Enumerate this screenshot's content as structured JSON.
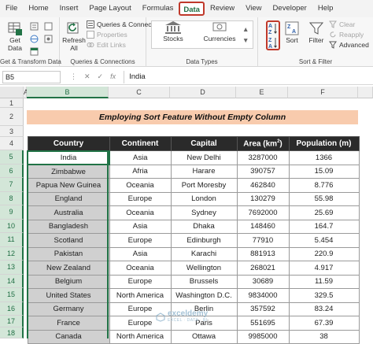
{
  "menu": [
    "File",
    "Home",
    "Insert",
    "Page Layout",
    "Formulas",
    "Data",
    "Review",
    "View",
    "Developer",
    "Help"
  ],
  "ribbon": {
    "get_data": "Get",
    "get_data_2": "Data",
    "get_group": "Get & Transform Data",
    "refresh": "Refresh",
    "refresh_2": "All",
    "queries_connections": "Queries & Connections",
    "properties": "Properties",
    "edit_links": "Edit Links",
    "queries_group": "Queries & Connections",
    "stocks": "Stocks",
    "currencies": "Currencies",
    "data_types_group": "Data Types",
    "sort": "Sort",
    "filter": "Filter",
    "clear": "Clear",
    "reapply": "Reapply",
    "advanced": "Advanced",
    "sort_filter_group": "Sort & Filter"
  },
  "formula_bar": {
    "name_box": "B5",
    "cancel": "✕",
    "enter": "✓",
    "fx": "fx",
    "value": "India"
  },
  "columns": [
    "A",
    "B",
    "C",
    "D",
    "E",
    "F"
  ],
  "rows": [
    "1",
    "2",
    "3",
    "4",
    "5",
    "6",
    "7",
    "8",
    "9",
    "10",
    "11",
    "12",
    "13",
    "14",
    "15",
    "16",
    "17",
    "18"
  ],
  "sheet_title": "Employing Sort Feature Without Empty Column",
  "table": {
    "headers": [
      "Country",
      "Continent",
      "Capital",
      "Area (km2)",
      "Population (m)"
    ],
    "area_base": "Area (km",
    "area_sup": "2",
    "area_close": ")",
    "rows": [
      [
        "India",
        "Asia",
        "New Delhi",
        "3287000",
        "1366"
      ],
      [
        "Zimbabwe",
        "Afria",
        "Harare",
        "390757",
        "15.09"
      ],
      [
        "Papua New Guinea",
        "Oceania",
        "Port Moresby",
        "462840",
        "8.776"
      ],
      [
        "England",
        "Europe",
        "London",
        "130279",
        "55.98"
      ],
      [
        "Australia",
        "Oceania",
        "Sydney",
        "7692000",
        "25.69"
      ],
      [
        "Bangladesh",
        "Asia",
        "Dhaka",
        "148460",
        "164.7"
      ],
      [
        "Scotland",
        "Europe",
        "Edinburgh",
        "77910",
        "5.454"
      ],
      [
        "Pakistan",
        "Asia",
        "Karachi",
        "881913",
        "220.9"
      ],
      [
        "New Zealand",
        "Oceania",
        "Wellington",
        "268021",
        "4.917"
      ],
      [
        "Belgium",
        "Europe",
        "Brussels",
        "30689",
        "11.59"
      ],
      [
        "United States",
        "North America",
        "Washington D.C.",
        "9834000",
        "329.5"
      ],
      [
        "Germany",
        "Europe",
        "Berlin",
        "357592",
        "83.24"
      ],
      [
        "France",
        "Europe",
        "Paris",
        "551695",
        "67.39"
      ],
      [
        "Canada",
        "North America",
        "Ottawa",
        "9985000",
        "38"
      ]
    ]
  },
  "watermark": {
    "name": "exceldemy",
    "sub": "EXCEL · DATA · BI"
  },
  "colors": {
    "excel_green": "#217346",
    "title_fill": "#f8cbad",
    "header_fill": "#2a2a2a",
    "highlight": "#c0392b"
  }
}
